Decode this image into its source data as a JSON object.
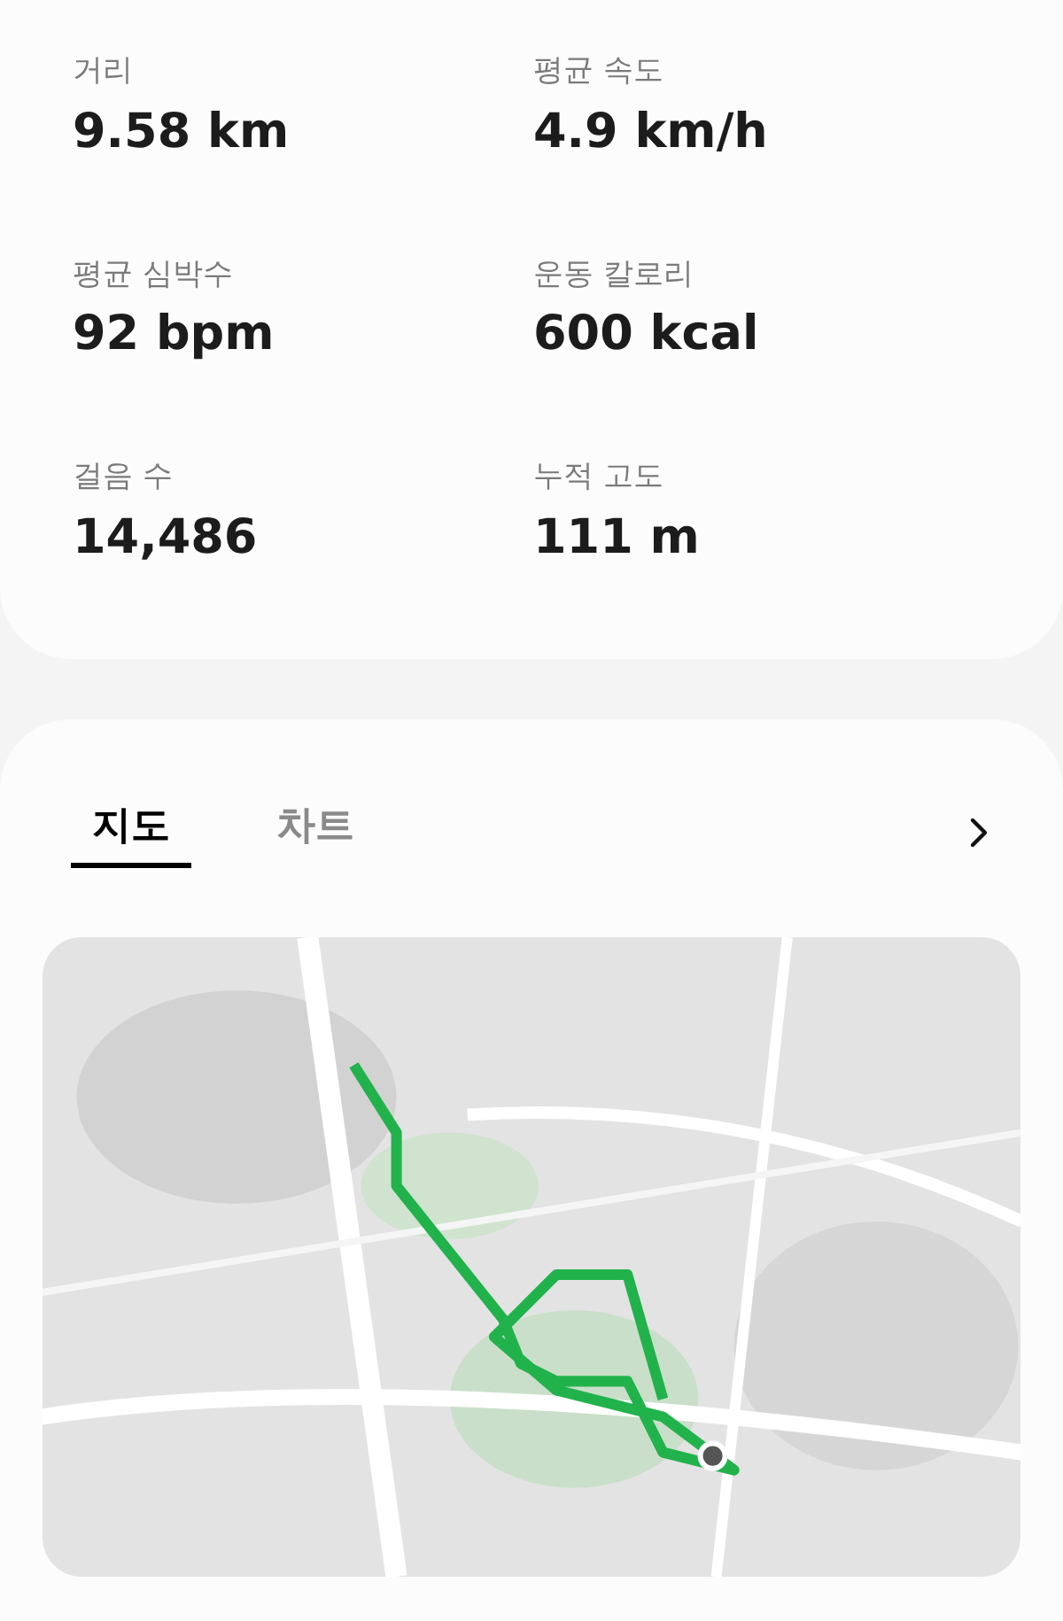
{
  "stats": [
    {
      "label": "거리",
      "value": "9.58 km"
    },
    {
      "label": "평균 속도",
      "value": "4.9 km/h"
    },
    {
      "label": "평균 심박수",
      "value": "92 bpm"
    },
    {
      "label": "운동 칼로리",
      "value": "600 kcal"
    },
    {
      "label": "걸음 수",
      "value": "14,486"
    },
    {
      "label": "누적 고도",
      "value": "111 m"
    }
  ],
  "tabs": [
    {
      "label": "지도",
      "selected": true
    },
    {
      "label": "차트",
      "selected": false
    }
  ]
}
